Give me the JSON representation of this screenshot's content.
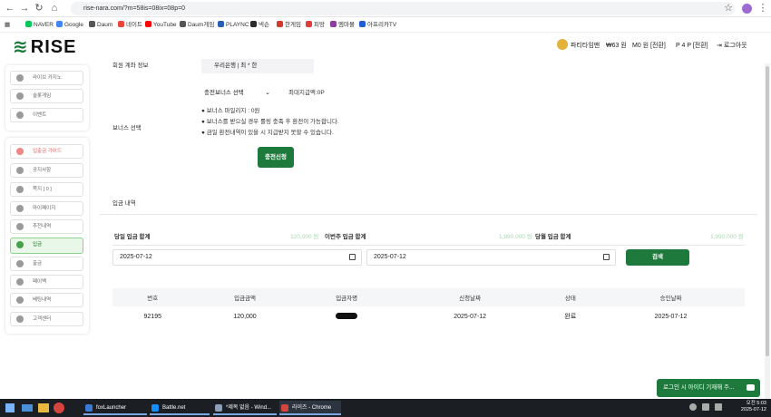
{
  "browser": {
    "url": "rise-nara.com/?m=58is=08ix=08p=0",
    "bookmarks": [
      {
        "label": "NAVER",
        "color": "#03c75a"
      },
      {
        "label": "Google",
        "color": "#4285f4"
      },
      {
        "label": "Daum",
        "color": "#555555"
      },
      {
        "label": "네이트",
        "color": "#e8453c"
      },
      {
        "label": "YouTube",
        "color": "#ff0000"
      },
      {
        "label": "Daum게임",
        "color": "#555555"
      },
      {
        "label": "PLAYNC",
        "color": "#2b5fb3"
      },
      {
        "label": "넥슨",
        "color": "#2b2b2b"
      },
      {
        "label": "한게임",
        "color": "#d43a2a"
      },
      {
        "label": "피망",
        "color": "#e23b3b"
      },
      {
        "label": "엠마몰",
        "color": "#8a3ea0"
      },
      {
        "label": "아프리카TV",
        "color": "#1e5dd6"
      }
    ]
  },
  "header": {
    "logo_text": "RISE",
    "user_name": "파티타임맨",
    "balance": "₩63 원",
    "points": "M0 원 [전환]",
    "p_points": "P 4 P [전환]",
    "logout": "로그아웃"
  },
  "sidebar": {
    "group1": [
      {
        "label": "라이브 카지노",
        "icon": "cards-icon"
      },
      {
        "label": "슬롯게임",
        "icon": "slot-icon"
      },
      {
        "label": "이벤트",
        "icon": "event-icon"
      }
    ],
    "group2": [
      {
        "label": "입출금 가이드",
        "icon": "guide-icon"
      },
      {
        "label": "공지사항",
        "icon": "notice-icon"
      },
      {
        "label": "쪽지 [ 0 ]",
        "icon": "message-icon"
      },
      {
        "label": "마이페이지",
        "icon": "user-icon"
      },
      {
        "label": "추천내역",
        "icon": "referral-icon"
      },
      {
        "label": "입금",
        "icon": "deposit-icon",
        "active": true
      },
      {
        "label": "출금",
        "icon": "withdraw-icon"
      },
      {
        "label": "페이백",
        "icon": "payback-icon"
      },
      {
        "label": "베팅내역",
        "icon": "betting-icon"
      },
      {
        "label": "고객센터",
        "icon": "support-icon"
      }
    ]
  },
  "form": {
    "account_label": "회원 계좌 정보",
    "account_value": "우리은행 | 최 * 한",
    "bonus_label": "보너스 선택",
    "bonus_select": "충전보너스 선택",
    "max_amount": "최대지급액:0P",
    "notes": [
      "● 보너스 마일리지 : 0원",
      "● 보너스를 받으실 경우 롤링 충족 후 환전이 가능합니다.",
      "● 금일 환전내역이 있을 시 지급받지 못할 수 있습니다."
    ],
    "submit": "충전신청"
  },
  "history": {
    "title": "입금 내역",
    "today_label": "당일 입금 합계",
    "today_value": "120,000 원",
    "week_label": "이번주 입금 합계",
    "week_value": "1,990,000 원",
    "day_label": "당월 입금 합계",
    "day_value": "1,990,000 원",
    "date_from": "2025-07-12",
    "date_to": "2025-07-12",
    "search": "검색",
    "columns": [
      "번호",
      "입금금액",
      "입금자명",
      "신청날짜",
      "상태",
      "승인날짜"
    ],
    "rows": [
      {
        "no": "92195",
        "amount": "120,000",
        "name": "",
        "date": "2025-07-12",
        "status": "완료",
        "approved": "2025-07-12"
      }
    ]
  },
  "chat_widget": "로그인 시 아이디 기재해 주...",
  "taskbar": {
    "apps": [
      "foxLauncher",
      "Battle.net",
      "*제목 없음 - Wind...",
      "라이즈 - Chrome"
    ],
    "time": "오전 5:03",
    "date": "2025-07-12"
  }
}
